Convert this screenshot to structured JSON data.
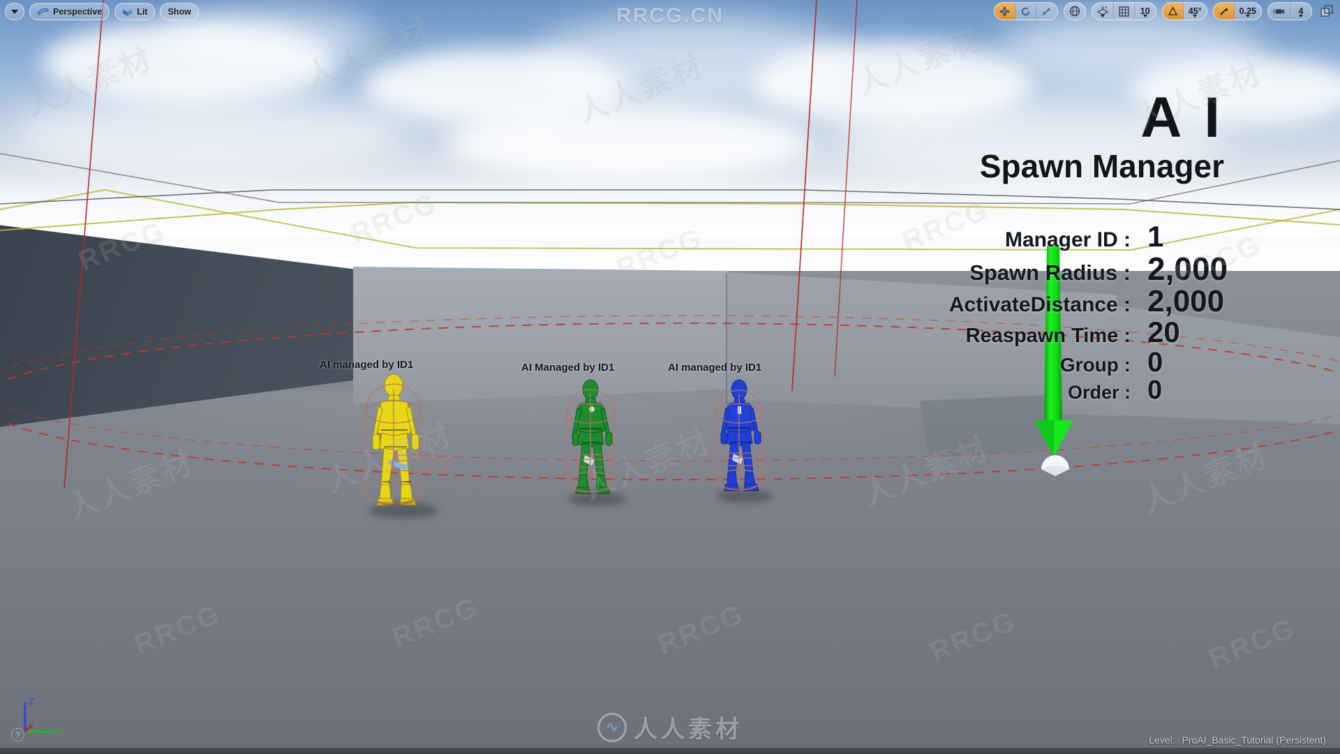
{
  "viewport": {
    "left_toolbar": {
      "dropdown_icon": "chevron-down-icon",
      "view_mode_label": "Perspective",
      "view_mode_icon": "perspective-camera-icon",
      "lighting_label": "Lit",
      "lighting_icon": "lit-cube-icon",
      "show_label": "Show"
    },
    "right_toolbar": {
      "transform_group": [
        {
          "name": "translate-mode",
          "icon": "move-arrows-icon",
          "active": true,
          "label": ""
        },
        {
          "name": "rotate-mode",
          "icon": "rotate-icon",
          "active": false,
          "label": ""
        },
        {
          "name": "scale-mode",
          "icon": "scale-icon",
          "active": false,
          "label": ""
        }
      ],
      "coordinate_system": {
        "name": "world-space-toggle",
        "icon": "globe-icon",
        "label": ""
      },
      "snapping_group": [
        {
          "name": "surface-snap",
          "icon": "surface-snap-icon",
          "active": false,
          "label": ""
        },
        {
          "name": "grid-snap",
          "icon": "grid-icon",
          "active": false,
          "label": ""
        },
        {
          "name": "grid-snap-value",
          "icon": "",
          "active": false,
          "label": "10"
        }
      ],
      "angle_group": [
        {
          "name": "angle-snap",
          "icon": "angle-icon",
          "active": true,
          "label": ""
        },
        {
          "name": "angle-snap-value",
          "icon": "",
          "active": false,
          "label": "45°"
        }
      ],
      "scale_group": [
        {
          "name": "scale-snap",
          "icon": "scale-snap-arrow-icon",
          "active": true,
          "label": ""
        },
        {
          "name": "scale-snap-value",
          "icon": "",
          "active": false,
          "label": "0.25"
        }
      ],
      "camera_group": [
        {
          "name": "camera-speed",
          "icon": "camera-icon",
          "active": false,
          "label": ""
        },
        {
          "name": "camera-speed-value",
          "icon": "",
          "active": false,
          "label": "4"
        }
      ],
      "maximize": {
        "name": "maximize-viewport",
        "icon": "maximize-icon",
        "label": ""
      }
    },
    "status": {
      "level_label": "Level:",
      "level_name": "ProAI_Basic_Tutorial (Persistent)",
      "help_icon": "question-mark-icon"
    },
    "axis_gizmo": {
      "x": {
        "label": "X",
        "color": "#cc2222"
      },
      "y": {
        "label": "Y",
        "color": "#22bb22"
      },
      "z": {
        "label": "Z",
        "color": "#3344dd"
      }
    }
  },
  "hud": {
    "title_line1": "A I",
    "title_line2": "Spawn Manager",
    "properties": [
      {
        "key": "Manager ID :",
        "value": "1"
      },
      {
        "key": "Spawn Radius :",
        "value": "2,000"
      },
      {
        "key": "ActivateDistance :",
        "value": "2,000"
      },
      {
        "key": "Reaspawn Time :",
        "value": "20"
      },
      {
        "key": "Group :",
        "value": "0"
      },
      {
        "key": "Order :",
        "value": "0"
      }
    ]
  },
  "scene": {
    "pawns": [
      {
        "label": "AI managed by ID1",
        "color": "#e8d718",
        "color_dark": "#b0a208",
        "name": "ai-pawn-yellow"
      },
      {
        "label": "AI Managed by ID1",
        "color": "#1f8a2e",
        "color_dark": "#14601f",
        "name": "ai-pawn-green"
      },
      {
        "label": "AI managed by ID1",
        "color": "#2040d8",
        "color_dark": "#152b93",
        "name": "ai-pawn-blue"
      }
    ],
    "spawn_arrow": {
      "name": "spawn-point-arrow",
      "color": "#12e81a",
      "direction": "down"
    },
    "collision_wire_color": "#b5746a",
    "spawn_radius_ring_color": "#c0392b",
    "navmesh_line_color": "#b8b83a"
  },
  "watermarks": {
    "top_center": "RRCG.CN",
    "bottom_center": "人人素材",
    "tiled_cn": "人人素材",
    "tiled_en": "RRCG"
  }
}
